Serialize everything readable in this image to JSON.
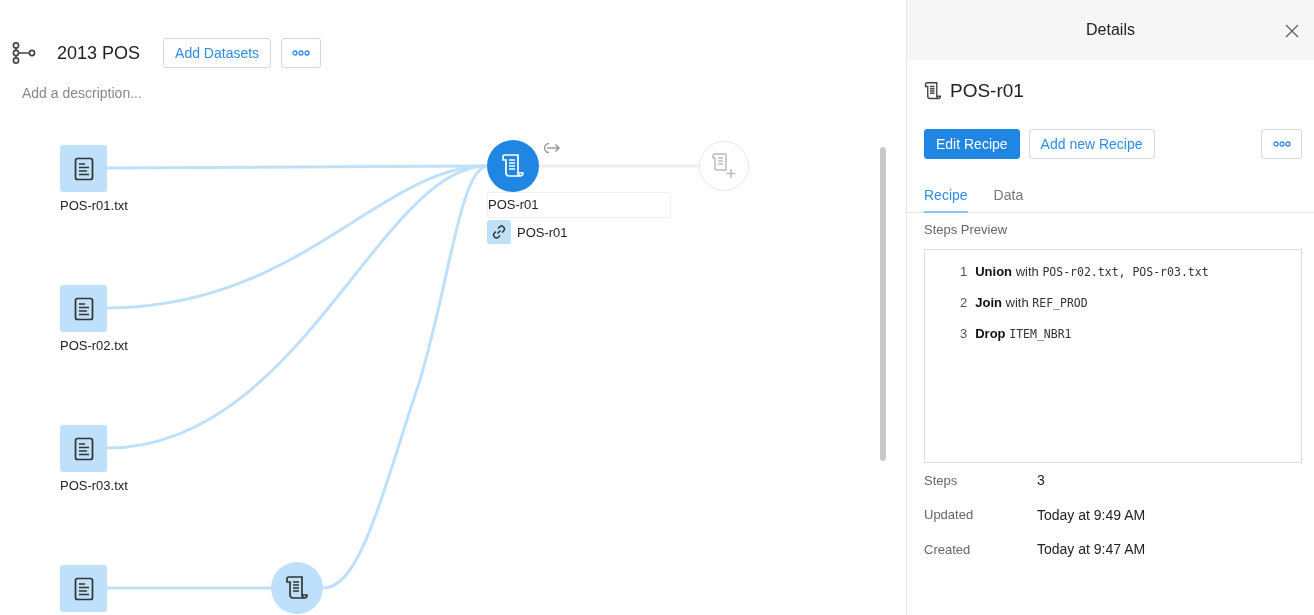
{
  "project": {
    "title": "2013 POS",
    "add_button": "Add Datasets",
    "description_placeholder": "Add a description..."
  },
  "nodes": [
    {
      "kind": "dataset",
      "label": "POS-r01.txt"
    },
    {
      "kind": "dataset",
      "label": "POS-r02.txt"
    },
    {
      "kind": "dataset",
      "label": "POS-r03.txt"
    },
    {
      "kind": "dataset"
    },
    {
      "kind": "recipe",
      "label": "POS-r01",
      "output": "POS-r01",
      "selected": true
    },
    {
      "kind": "recipe",
      "selected": false
    },
    {
      "kind": "add-recipe"
    }
  ],
  "details": {
    "title": "Details",
    "name": "POS-r01",
    "primary_button": "Edit Recipe",
    "secondary_button": "Add new Recipe",
    "tabs": [
      {
        "label": "Recipe",
        "selected": true
      },
      {
        "label": "Data",
        "selected": false
      }
    ],
    "preview_label": "Steps Preview",
    "steps": [
      {
        "number": "1",
        "action": "Union",
        "joiner": "with",
        "args": "POS-r02.txt, POS-r03.txt"
      },
      {
        "number": "2",
        "action": "Join",
        "joiner": "with",
        "args": "REF_PROD"
      },
      {
        "number": "3",
        "action": "Drop",
        "args": "ITEM_NBR1"
      }
    ],
    "info": [
      {
        "label": "Steps",
        "value": "3"
      },
      {
        "label": "Updated",
        "value": "Today at 9:49 AM"
      },
      {
        "label": "Created",
        "value": "Today at 9:47 AM"
      }
    ]
  }
}
